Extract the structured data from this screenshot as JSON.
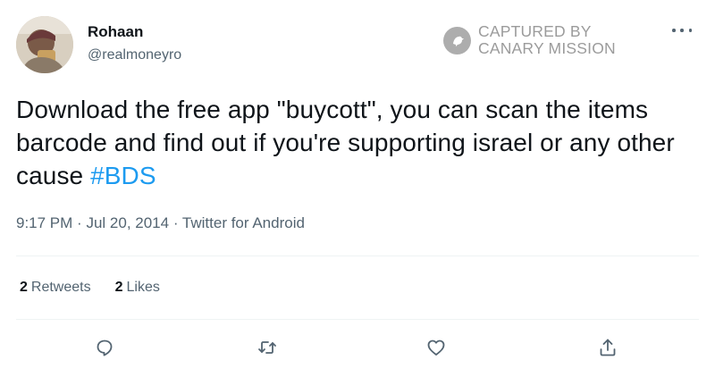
{
  "tweet": {
    "author_name": "Rohaan",
    "author_handle": "@realmoneyro",
    "text_main": "Download the free app \"buycott\", you can scan the items barcode and find out if you're supporting israel or any other cause ",
    "hashtag": "#BDS",
    "time": "9:17 PM",
    "date": "Jul 20, 2014",
    "source": "Twitter for Android",
    "separator": "·"
  },
  "stats": {
    "retweets_count": "2",
    "retweets_label": "Retweets",
    "likes_count": "2",
    "likes_label": "Likes"
  },
  "watermark": {
    "line1": "CAPTURED BY",
    "line2": "CANARY MISSION"
  },
  "icons": {
    "more": "more-icon",
    "reply": "reply-icon",
    "retweet": "retweet-icon",
    "like": "like-icon",
    "share": "share-icon"
  },
  "colors": {
    "text": "#0f1419",
    "secondary": "#536471",
    "link": "#1d9bf0",
    "divider": "#eff3f4"
  }
}
